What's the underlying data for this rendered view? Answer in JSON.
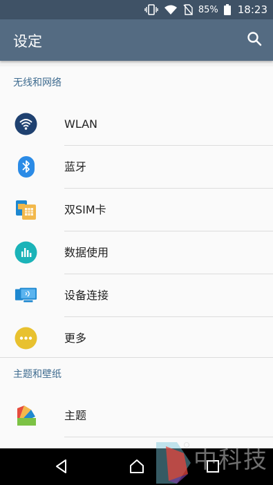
{
  "status_bar": {
    "battery": "85%",
    "time": "18:23",
    "icons": [
      "vibrate-icon",
      "wifi-icon",
      "no-sim-icon",
      "battery-icon"
    ]
  },
  "app_bar": {
    "title": "设定",
    "search_icon": "search-icon"
  },
  "sections": [
    {
      "header": "无线和网络",
      "items": [
        {
          "label": "WLAN",
          "icon": "wifi-icon",
          "color": "#1f4170"
        },
        {
          "label": "蓝牙",
          "icon": "bluetooth-icon",
          "color": "#2b8be6"
        },
        {
          "label": "双SIM卡",
          "icon": "dual-sim-icon",
          "color": "#f2b84b"
        },
        {
          "label": "数据使用",
          "icon": "data-usage-icon",
          "color": "#1bb3b8"
        },
        {
          "label": "设备连接",
          "icon": "device-connection-icon",
          "color": "#1e88d0"
        },
        {
          "label": "更多",
          "icon": "more-icon",
          "color": "#e8c12f"
        }
      ]
    },
    {
      "header": "主题和壁纸",
      "items": [
        {
          "label": "主题",
          "icon": "theme-icon",
          "color": "#e64d3d"
        }
      ]
    }
  ],
  "nav_bar": {
    "buttons": [
      "back-icon",
      "home-icon",
      "recents-icon"
    ]
  },
  "watermark": {
    "text": "中科技"
  }
}
